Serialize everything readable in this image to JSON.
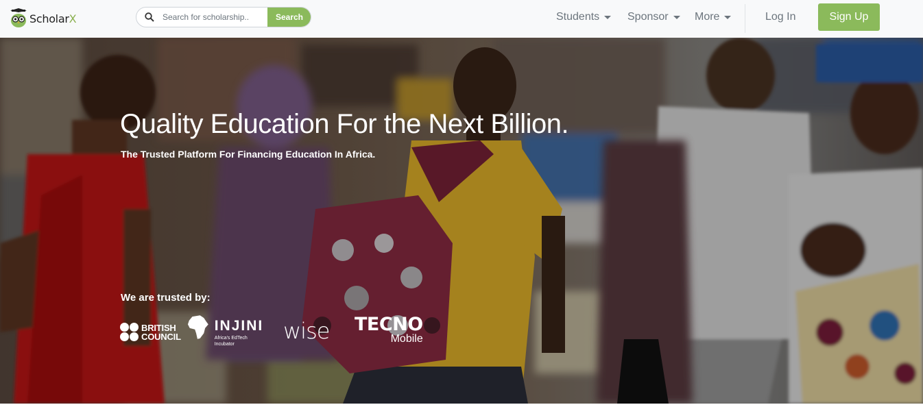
{
  "brand": {
    "name_main": "Scholar",
    "name_accent": "X",
    "accent_color": "#8bba5b"
  },
  "search": {
    "placeholder": "Search for scholarship..",
    "button_label": "Search"
  },
  "nav": {
    "items": [
      {
        "label": "Students"
      },
      {
        "label": "Sponsor"
      },
      {
        "label": "More"
      }
    ],
    "login_label": "Log In",
    "signup_label": "Sign Up"
  },
  "hero": {
    "title": "Quality Education For the Next Billion.",
    "subtitle": "The Trusted Platform For Financing Education In Africa.",
    "trusted_label": "We are trusted by:",
    "partners": {
      "british_council": "BRITISH\nCOUNCIL",
      "injini": "INJINI",
      "injini_tagline": "Africa's EdTech Incubator",
      "wise": "wise",
      "tecno": "TECNO",
      "tecno_sub": "Mobile"
    }
  },
  "icons": [
    "logo-owl-icon",
    "search-icon",
    "chevron-down-icon",
    "africa-map-icon"
  ]
}
